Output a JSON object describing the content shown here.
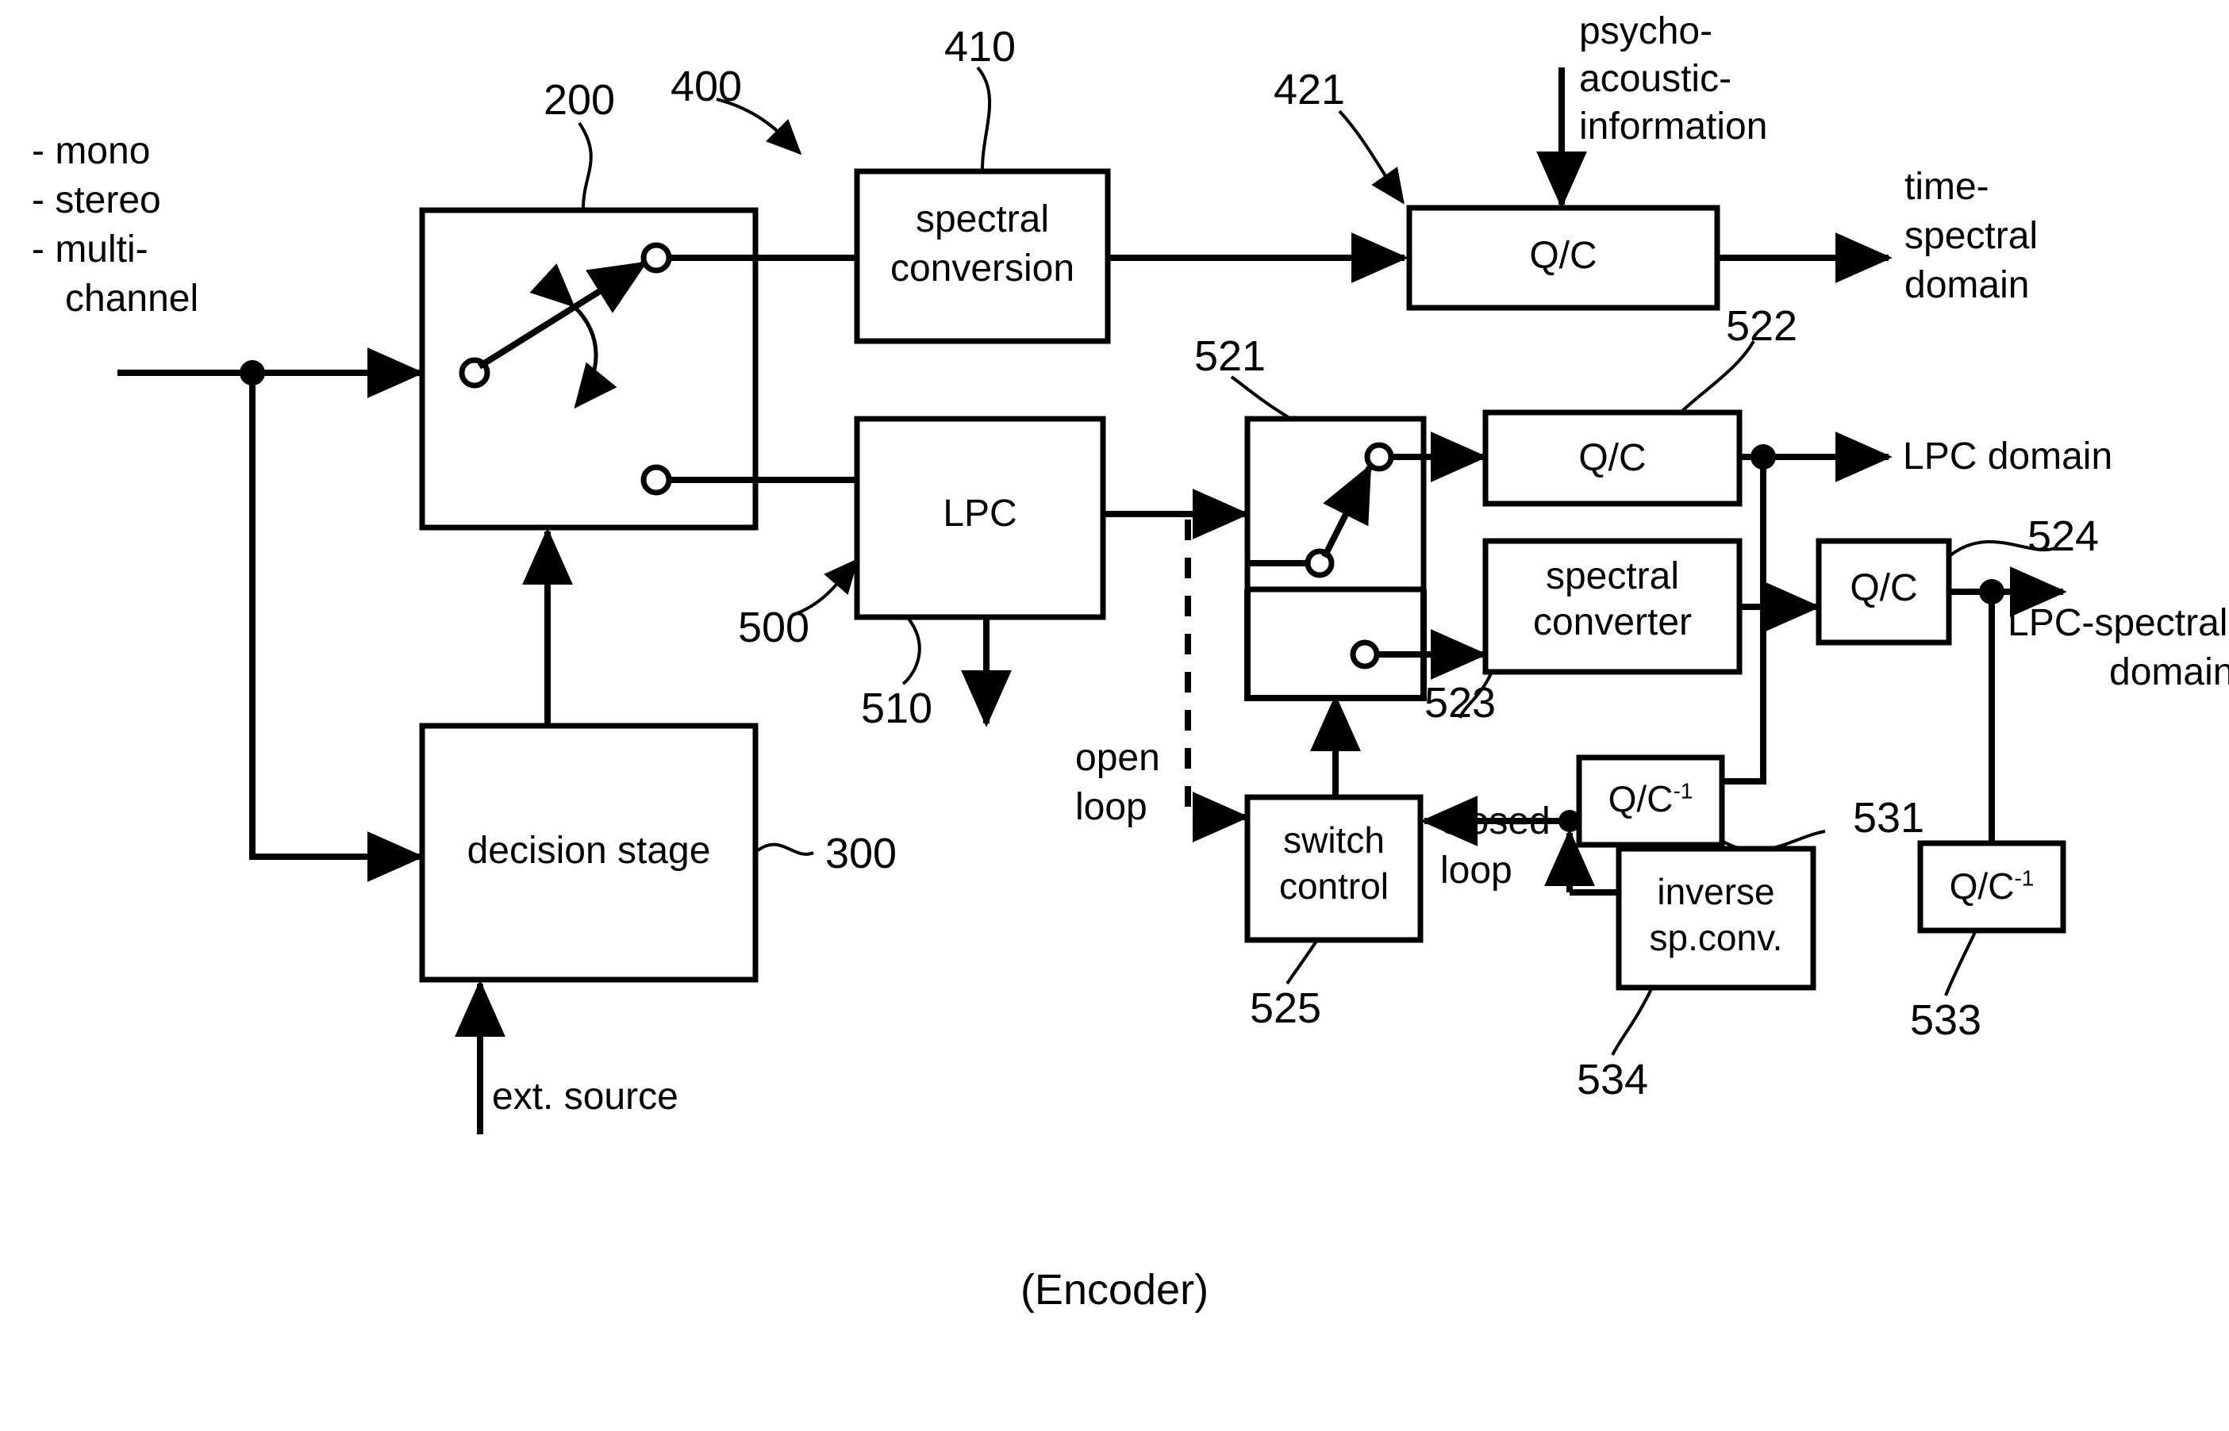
{
  "figure": {
    "caption": "(Encoder)",
    "input_list": [
      "- mono",
      "- stereo",
      "- multi-",
      "channel"
    ],
    "ext_source_label": "ext. source",
    "psychoacoustic_label": [
      "psycho-",
      "acoustic-",
      "information"
    ],
    "open_loop_label": [
      "open",
      "loop"
    ],
    "closed_loop_label": [
      "closed",
      "loop"
    ]
  },
  "blocks": {
    "switch_200": {
      "label": "",
      "ref": "200"
    },
    "spectral_conversion_410": {
      "label_line1": "spectral",
      "label_line2": "conversion",
      "ref": "410"
    },
    "qc_421": {
      "label": "Q/C",
      "ref": "421"
    },
    "lpc_500": {
      "label": "LPC",
      "ref": "500"
    },
    "decision_stage_300": {
      "label": "decision stage",
      "ref": "300"
    },
    "switch_521": {
      "label": "",
      "ref": "521"
    },
    "qc_522": {
      "label": "Q/C",
      "ref": "522"
    },
    "spectral_converter_523": {
      "label_line1": "spectral",
      "label_line2": "converter",
      "ref": "523"
    },
    "qc_524": {
      "label": "Q/C",
      "ref": "524"
    },
    "switch_control_525": {
      "label_line1": "switch",
      "label_line2": "control",
      "ref": "525"
    },
    "qc_inv_531": {
      "label": "Q/C",
      "sup": "-1",
      "ref": "531"
    },
    "qc_inv_533": {
      "label": "Q/C",
      "sup": "-1",
      "ref": "533"
    },
    "inverse_sp_conv_534": {
      "label_line1": "inverse",
      "label_line2": "sp.conv.",
      "ref": "534"
    }
  },
  "refs": {
    "r200": "200",
    "r300": "300",
    "r400": "400",
    "r410": "410",
    "r421": "421",
    "r500": "500",
    "r510": "510",
    "r521": "521",
    "r522": "522",
    "r523": "523",
    "r524": "524",
    "r525": "525",
    "r531": "531",
    "r533": "533",
    "r534": "534"
  },
  "outputs": {
    "time_spectral": [
      "time-",
      "spectral",
      "domain"
    ],
    "lpc_domain": "LPC domain",
    "lpc_spectral": [
      "LPC-spectral",
      "domain"
    ]
  },
  "colors": {
    "ink": "#000000",
    "paper": "#ffffff"
  }
}
